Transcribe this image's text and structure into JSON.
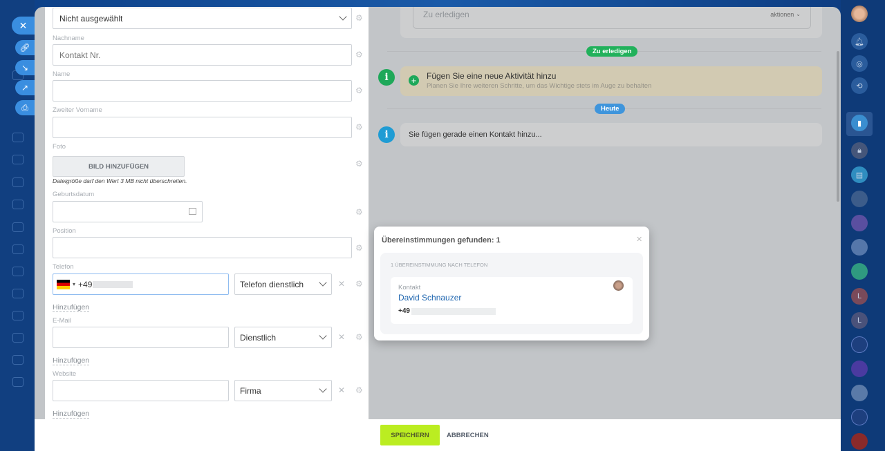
{
  "form": {
    "select_value": "Nicht ausgewählt",
    "nachname_label": "Nachname",
    "nachname_placeholder": "Kontakt Nr.",
    "name_label": "Name",
    "zweiter_label": "Zweiter Vorname",
    "foto_label": "Foto",
    "foto_button": "BILD HINZUFÜGEN",
    "foto_hint": "Dateigröße darf den Wert 3 MB nicht überschreiten.",
    "geburtsdatum_label": "Geburtsdatum",
    "position_label": "Position",
    "telefon_label": "Telefon",
    "telefon_value": "+49",
    "telefon_type": "Telefon dienstlich",
    "email_label": "E-Mail",
    "email_type": "Dienstlich",
    "website_label": "Website",
    "website_type": "Firma",
    "add_label": "Hinzufügen"
  },
  "timeline": {
    "todo_placeholder": "Zu erledigen",
    "actions": "aktionen",
    "pill_todo": "Zu erledigen",
    "activity_title": "Fügen Sie eine neue Aktivität hinzu",
    "activity_sub": "Planen Sie Ihre weiteren Schritte, um das Wichtige stets im Auge zu behalten",
    "pill_today": "Heute",
    "adding_text": "Sie fügen gerade einen Kontakt hinzu..."
  },
  "popup": {
    "title": "Übereinstimmungen gefunden: 1",
    "section": "1 ÜBEREINSTIMMUNG NACH TELEFON",
    "type": "Kontakt",
    "name": "David Schnauzer",
    "phone": "+49"
  },
  "footer": {
    "save": "SPEICHERN",
    "cancel": "ABBRECHEN"
  },
  "sidebar": {
    "letters": [
      "L",
      "L"
    ]
  },
  "colors": {
    "accent": "#3a8ee0",
    "green": "#21b15b",
    "save": "#bbed21",
    "link": "#2067b0"
  }
}
